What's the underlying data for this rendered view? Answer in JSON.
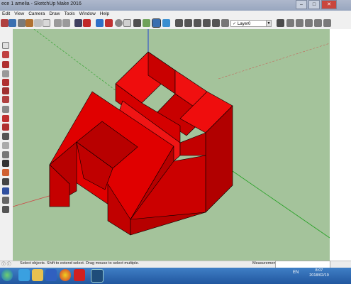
{
  "window": {
    "title": "ece 1 amelia - SketchUp Make 2016"
  },
  "menu": [
    "Edit",
    "View",
    "Camera",
    "Draw",
    "Tools",
    "Window",
    "Help"
  ],
  "toolbar": {
    "layer_name": "Layer0",
    "tools": [
      "select-tool",
      "eraser-tool",
      "paint-tool",
      "pencil-tool",
      "rectangle-tool",
      "push-pull-tool",
      "move-tool",
      "rotate-tool",
      "offset-tool",
      "tape-measure-tool",
      "text-tool",
      "3d-text-tool",
      "axes-tool",
      "walk-tool",
      "orbit-tool",
      "pan-tool",
      "zoom-tool",
      "zoom-extents-tool",
      "iso-view",
      "top-view",
      "front-view",
      "right-view",
      "back-view",
      "left-view",
      "layers-tool"
    ]
  },
  "model": {
    "face_color": "#e00000",
    "edge_color": "#000000",
    "background": "#a4c39b"
  },
  "statusbar": {
    "hint": "Select objects. Shift to extend select. Drag mouse to select multiple.",
    "measurements_label": "Measurements",
    "measurements_value": ""
  },
  "taskbar": {
    "language": "EN",
    "time": "8:07",
    "date": "2018/02/19"
  },
  "colors": {
    "title_bar": "#a9b5ca",
    "taskbar": "#2b65ad",
    "viewport_bg": "#a4c39b",
    "axis_red": "#d04040",
    "axis_green": "#20a020",
    "axis_blue": "#2040d0"
  }
}
